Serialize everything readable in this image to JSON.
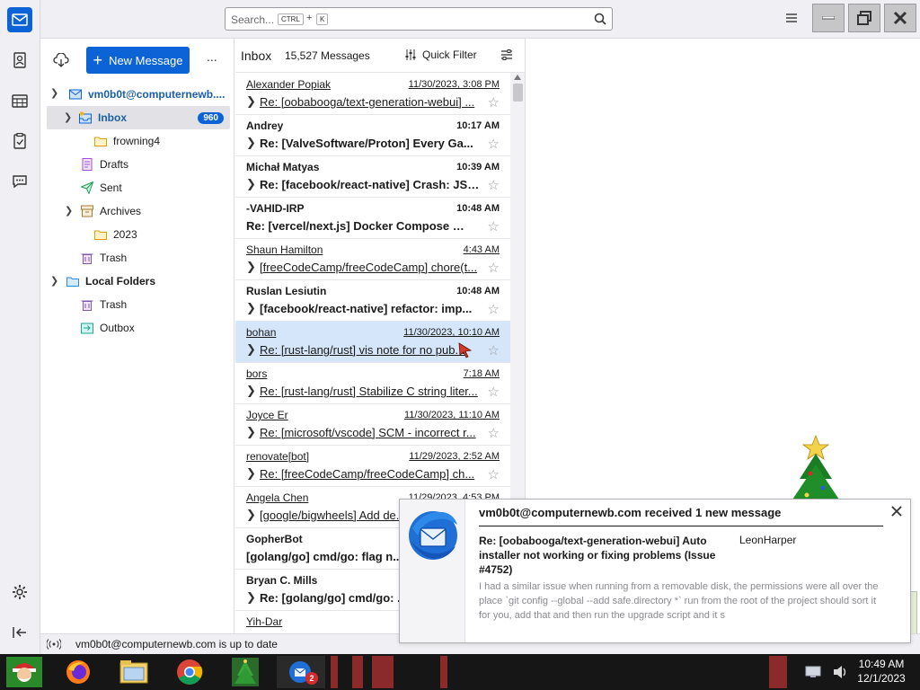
{
  "window": {
    "search_placeholder": "Search...",
    "search_key_ctrl": "CTRL",
    "search_key_plus": "+",
    "search_key_k": "K"
  },
  "toolbar": {
    "new_message_label": "New Message",
    "more_label": "..."
  },
  "folders": {
    "account": "vm0b0t@computernewb....",
    "items": [
      {
        "label": "Inbox",
        "badge": "960"
      },
      {
        "label": "frowning4"
      },
      {
        "label": "Drafts"
      },
      {
        "label": "Sent"
      },
      {
        "label": "Archives"
      },
      {
        "label": "2023"
      },
      {
        "label": "Trash"
      },
      {
        "label": "Local Folders"
      },
      {
        "label": "Trash"
      },
      {
        "label": "Outbox"
      }
    ]
  },
  "list": {
    "folder_title": "Inbox",
    "message_count": "15,527 Messages",
    "quick_filter_label": "Quick Filter",
    "messages": [
      {
        "sender": "Alexander Popiak",
        "date": "11/30/2023, 3:08 PM",
        "subject": "Re: [oobabooga/text-generation-webui] ..."
      },
      {
        "sender": "Andrey",
        "date": "10:17 AM",
        "subject": "Re: [ValveSoftware/Proton] Every Ga..."
      },
      {
        "sender": "Michał Matyas",
        "date": "10:39 AM",
        "subject": "Re: [facebook/react-native] Crash: JS ..."
      },
      {
        "sender": "-VAHID-IRP",
        "date": "10:48 AM",
        "subject": "Re: [vercel/next.js] Docker Compose Ne..."
      },
      {
        "sender": "Shaun Hamilton",
        "date": "4:43 AM",
        "subject": "[freeCodeCamp/freeCodeCamp] chore(t..."
      },
      {
        "sender": "Ruslan Lesiutin",
        "date": "10:48 AM",
        "subject": "[facebook/react-native] refactor: imp..."
      },
      {
        "sender": "bohan",
        "date": "11/30/2023, 10:10 AM",
        "subject": "Re: [rust-lang/rust] vis note for no pub..."
      },
      {
        "sender": "bors",
        "date": "7:18 AM",
        "subject": "Re: [rust-lang/rust] Stabilize C string liter..."
      },
      {
        "sender": "Joyce Er",
        "date": "11/30/2023, 11:10 AM",
        "subject": "Re: [microsoft/vscode] SCM - incorrect r..."
      },
      {
        "sender": "renovate[bot]",
        "date": "11/29/2023, 2:52 AM",
        "subject": "Re: [freeCodeCamp/freeCodeCamp] ch..."
      },
      {
        "sender": "Angela Chen",
        "date": "11/29/2023, 4:53 PM",
        "subject": "[google/bigwheels] Add de..."
      },
      {
        "sender": "GopherBot",
        "date": "",
        "subject": "[golang/go] cmd/go: flag n..."
      },
      {
        "sender": "Bryan C. Mills",
        "date": "",
        "subject": "Re: [golang/go] cmd/go: ..."
      },
      {
        "sender": "Yih-Dar",
        "date": "",
        "subject": ""
      }
    ]
  },
  "status": {
    "text": "vm0b0t@computernewb.com is up to date"
  },
  "notification": {
    "title": "vm0b0t@computernewb.com received 1 new message",
    "subject": "Re: [oobabooga/text-generation-webui] Auto installer not working or fixing problems (Issue #4752)",
    "sender": "LeonHarper",
    "preview": "I had a similar issue when running from a removable disk, the permissions were all over the place `git config --global --add safe.directory *` run from the root of the project should sort it for you, add that and then run the upgrade script and it s"
  },
  "taskbar": {
    "time": "10:49 AM",
    "date": "12/1/2023",
    "thunderbird_badge": "2"
  },
  "colors": {
    "accent": "#0b63d6",
    "selected_row": "#d5e6fb"
  }
}
